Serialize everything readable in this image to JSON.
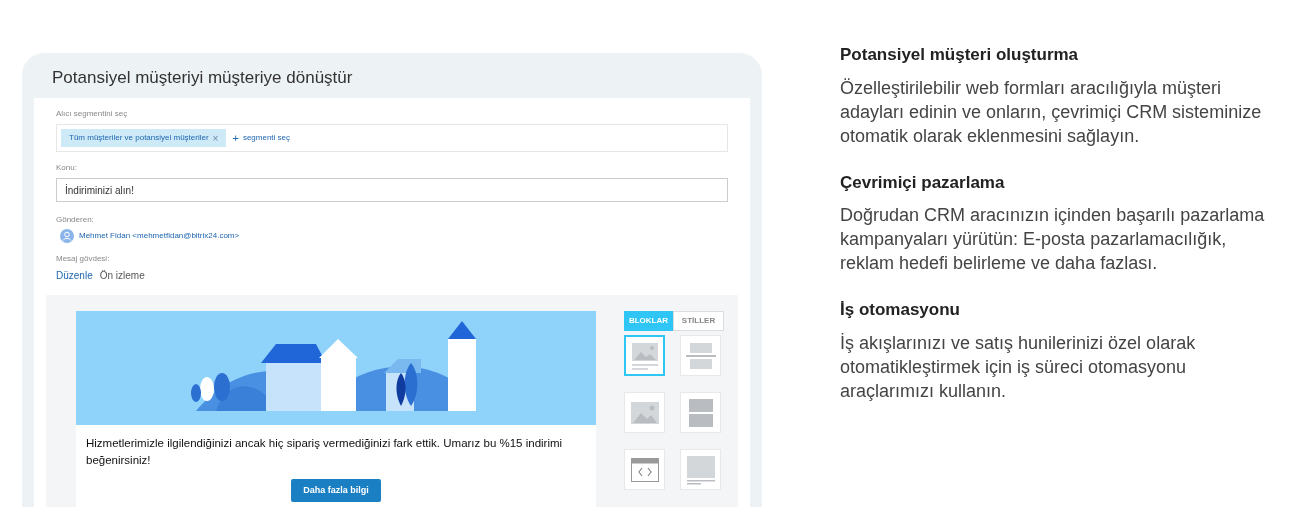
{
  "mockup": {
    "title": "Potansiyel müşteriyi müşteriye dönüştür",
    "recipient": {
      "label": "Alıcı segmentini seç",
      "tag": "Tüm müşteriler ve potansiyel müşteriler",
      "tag_close": "×",
      "add": "+",
      "add_label": "segmenti seç"
    },
    "subject": {
      "label": "Konu:",
      "value": "İndiriminizi alın!"
    },
    "sender": {
      "label": "Gönderen:",
      "name": "Mehmet Fidan <mehmetfidan@bitrix24.com>"
    },
    "body": {
      "label": "Mesaj gövdesi:",
      "tabs": [
        {
          "label": "Düzenle",
          "selected": true
        },
        {
          "label": "Ön izleme",
          "selected": false
        }
      ]
    },
    "email": {
      "text": "Hizmetlerimizle ilgilendiğinizi ancak hiç sipariş vermediğinizi fark ettik. Umarız bu %15 indirimi beğenirsiniz!",
      "button": "Daha fazla bilgi"
    },
    "panel_tabs": [
      {
        "label": "BLOKLAR",
        "selected": true
      },
      {
        "label": "STİLLER",
        "selected": false
      }
    ],
    "blocks": [
      {
        "kind": "image-text",
        "selected": true
      },
      {
        "kind": "divider",
        "selected": false
      },
      {
        "kind": "image",
        "selected": false
      },
      {
        "kind": "two-boxes",
        "selected": false
      },
      {
        "kind": "code",
        "selected": false
      },
      {
        "kind": "text-box",
        "selected": false
      }
    ]
  },
  "features": [
    {
      "title": "Potansiyel müşteri oluşturma",
      "text": "Özelleştirilebilir web formları aracılığıyla müşteri adayları edinin ve onların, çevrimiçi CRM sisteminize otomatik olarak eklenmesini sağlayın."
    },
    {
      "title": "Çevrimiçi pazarlama",
      "text": "Doğrudan CRM aracınızın içinden başarılı pazarlama kampanyaları yürütün: E-posta pazarlamacılığık, reklam hedefi belirleme ve daha fazlası."
    },
    {
      "title": "İş otomasyonu",
      "text": "İş akışlarınızı ve satış hunilerinizi özel olarak otomatikleştirmek için iş süreci otomasyonu araçlarımızı kullanın."
    }
  ]
}
